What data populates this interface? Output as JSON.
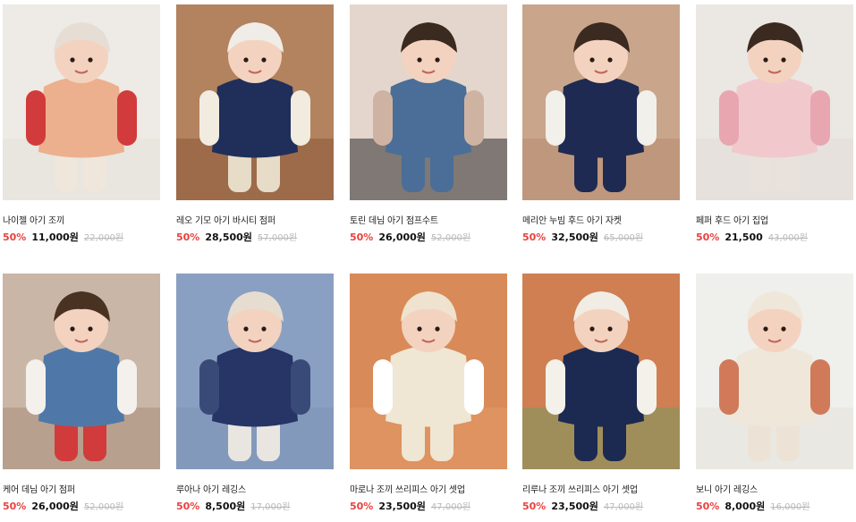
{
  "products": [
    {
      "name": "나이젤 아기 조끼",
      "discount": "50%",
      "price": "11,000원",
      "original": "22,000원",
      "bg": "#eeeae5",
      "top": "#ecb08e",
      "bottom": "#efe6dc",
      "accent": "#d23b3b",
      "hat": "#e6ded4",
      "scene": "#e5e0da"
    },
    {
      "name": "레오 기모 아기 바시티 점퍼",
      "discount": "50%",
      "price": "28,500원",
      "original": "57,000원",
      "bg": "#b3825e",
      "top": "#1f2f5a",
      "bottom": "#e6dcc8",
      "accent": "#f1ebe0",
      "hat": "#f0ede8",
      "scene": "#8a5a3a"
    },
    {
      "name": "토린 데님 아기 점프수트",
      "discount": "50%",
      "price": "26,000원",
      "original": "52,000원",
      "bg": "#e4d6cc",
      "top": "#4a6e98",
      "bottom": "#4a6e98",
      "accent": "#cfb3a2",
      "hat": "#3b2a20",
      "scene": "#2b2b2b"
    },
    {
      "name": "메리안 누빔 후드 아기 자켓",
      "discount": "50%",
      "price": "32,500원",
      "original": "65,000원",
      "bg": "#c9a58c",
      "top": "#1f2a52",
      "bottom": "#1f2a52",
      "accent": "#f2f0ea",
      "hat": "#3b2a20",
      "scene": "#b78c70"
    },
    {
      "name": "페퍼 후드 아기 집업",
      "discount": "50%",
      "price": "21,500",
      "original": "43,000원",
      "bg": "#ebe7e2",
      "top": "#f1c9cd",
      "bottom": "#e9e2dc",
      "accent": "#e8a6b0",
      "hat": "#3b2a20",
      "scene": "#e2ddd7"
    },
    {
      "name": "케어 데님 아기 점퍼",
      "discount": "50%",
      "price": "26,000원",
      "original": "52,000원",
      "bg": "#c9b6a6",
      "top": "#4f78a8",
      "bottom": "#d23b3b",
      "accent": "#f4f0ec",
      "hat": "#4a3223",
      "scene": "#a88e78"
    },
    {
      "name": "루아나 아기 레깅스",
      "discount": "50%",
      "price": "8,500원",
      "original": "17,000원",
      "bg": "#8aa0c2",
      "top": "#263466",
      "bottom": "#e9e6e2",
      "accent": "#3a4a78",
      "hat": "#e6ddd0",
      "scene": "#7d93b6"
    },
    {
      "name": "마로나 조끼 쓰리피스 아기 셋업",
      "discount": "50%",
      "price": "23,500원",
      "original": "47,000원",
      "bg": "#d88a58",
      "top": "#efe6d4",
      "bottom": "#efe6d4",
      "accent": "#ffffff",
      "hat": "#efe3cf",
      "scene": "#e39a68"
    },
    {
      "name": "리루나 조끼 쓰리피스 아기 셋업",
      "discount": "50%",
      "price": "23,500원",
      "original": "47,000원",
      "bg": "#cf7f52",
      "top": "#1c2a52",
      "bottom": "#1c2a52",
      "accent": "#f4f1ea",
      "hat": "#f1ede4",
      "scene": "#7a9a60"
    },
    {
      "name": "보니 아기 레깅스",
      "discount": "50%",
      "price": "8,000원",
      "original": "16,000원",
      "bg": "#efefec",
      "top": "#efe7da",
      "bottom": "#ece3d6",
      "accent": "#d07a5a",
      "hat": "#efe7da",
      "scene": "#e4e2dd"
    }
  ]
}
